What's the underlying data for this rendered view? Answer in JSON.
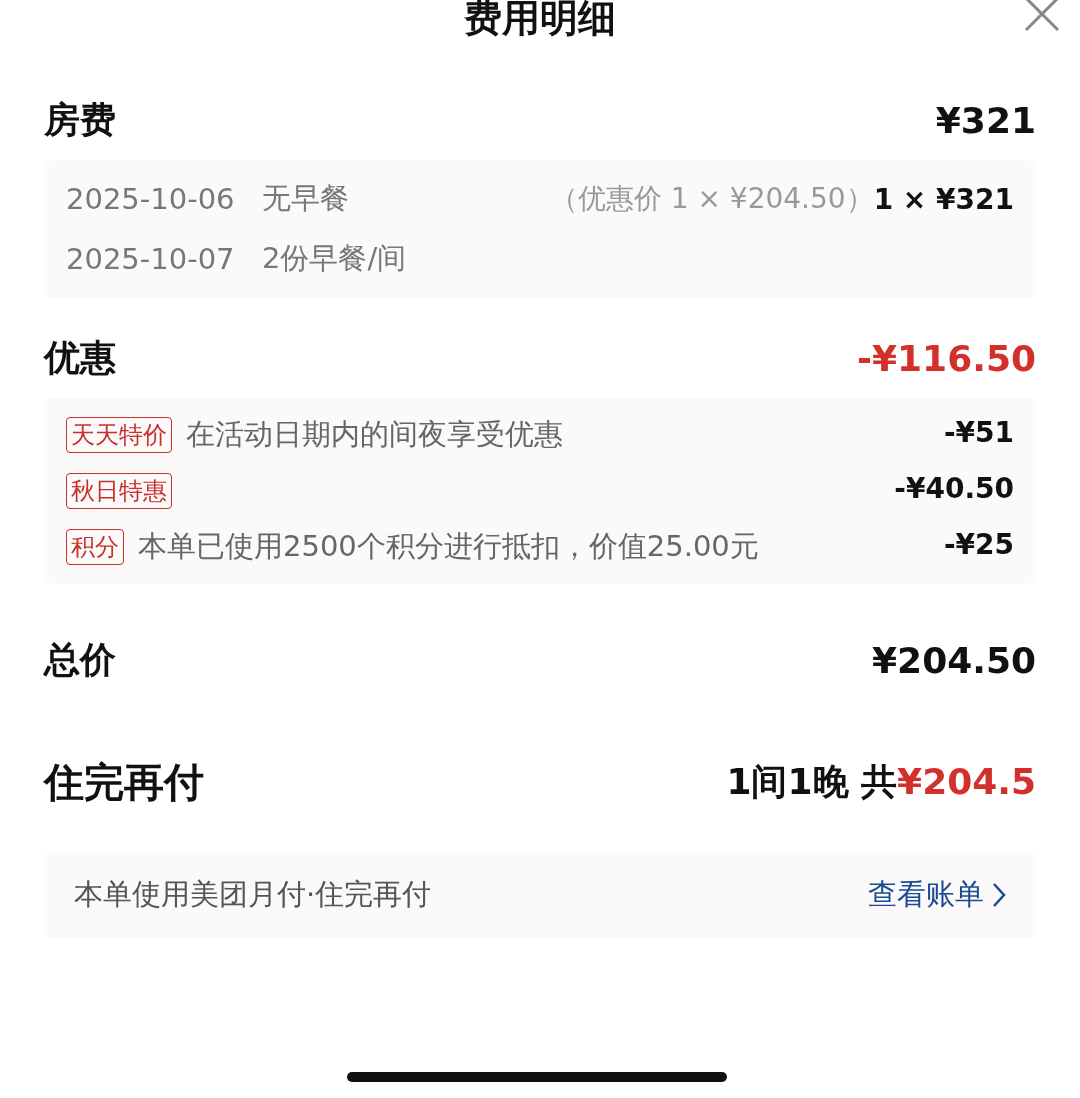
{
  "header": {
    "title": "费用明细"
  },
  "room": {
    "label": "房费",
    "amount": "¥321",
    "nights": [
      {
        "date": "2025-10-06",
        "meal": "无早餐",
        "note": "（优惠价 1 × ¥204.50）",
        "price": "1 × ¥321"
      },
      {
        "date": "2025-10-07",
        "meal": "2份早餐/间"
      }
    ]
  },
  "discount": {
    "label": "优惠",
    "amount": "-¥116.50",
    "items": [
      {
        "tag": "天天特价",
        "desc": "在活动日期内的间夜享受优惠",
        "amount": "-¥51"
      },
      {
        "tag": "秋日特惠",
        "amount": "-¥40.50"
      },
      {
        "tag": "积分",
        "desc": "本单已使用2500个积分进行抵扣，价值25.00元",
        "amount": "-¥25"
      }
    ]
  },
  "total": {
    "label": "总价",
    "amount": "¥204.50"
  },
  "pay_later": {
    "label": "住完再付",
    "summary": "1间1晚 共",
    "amount": "¥204.5"
  },
  "notice": {
    "text": "本单使用美团月付·住完再付",
    "link": "查看账单"
  }
}
